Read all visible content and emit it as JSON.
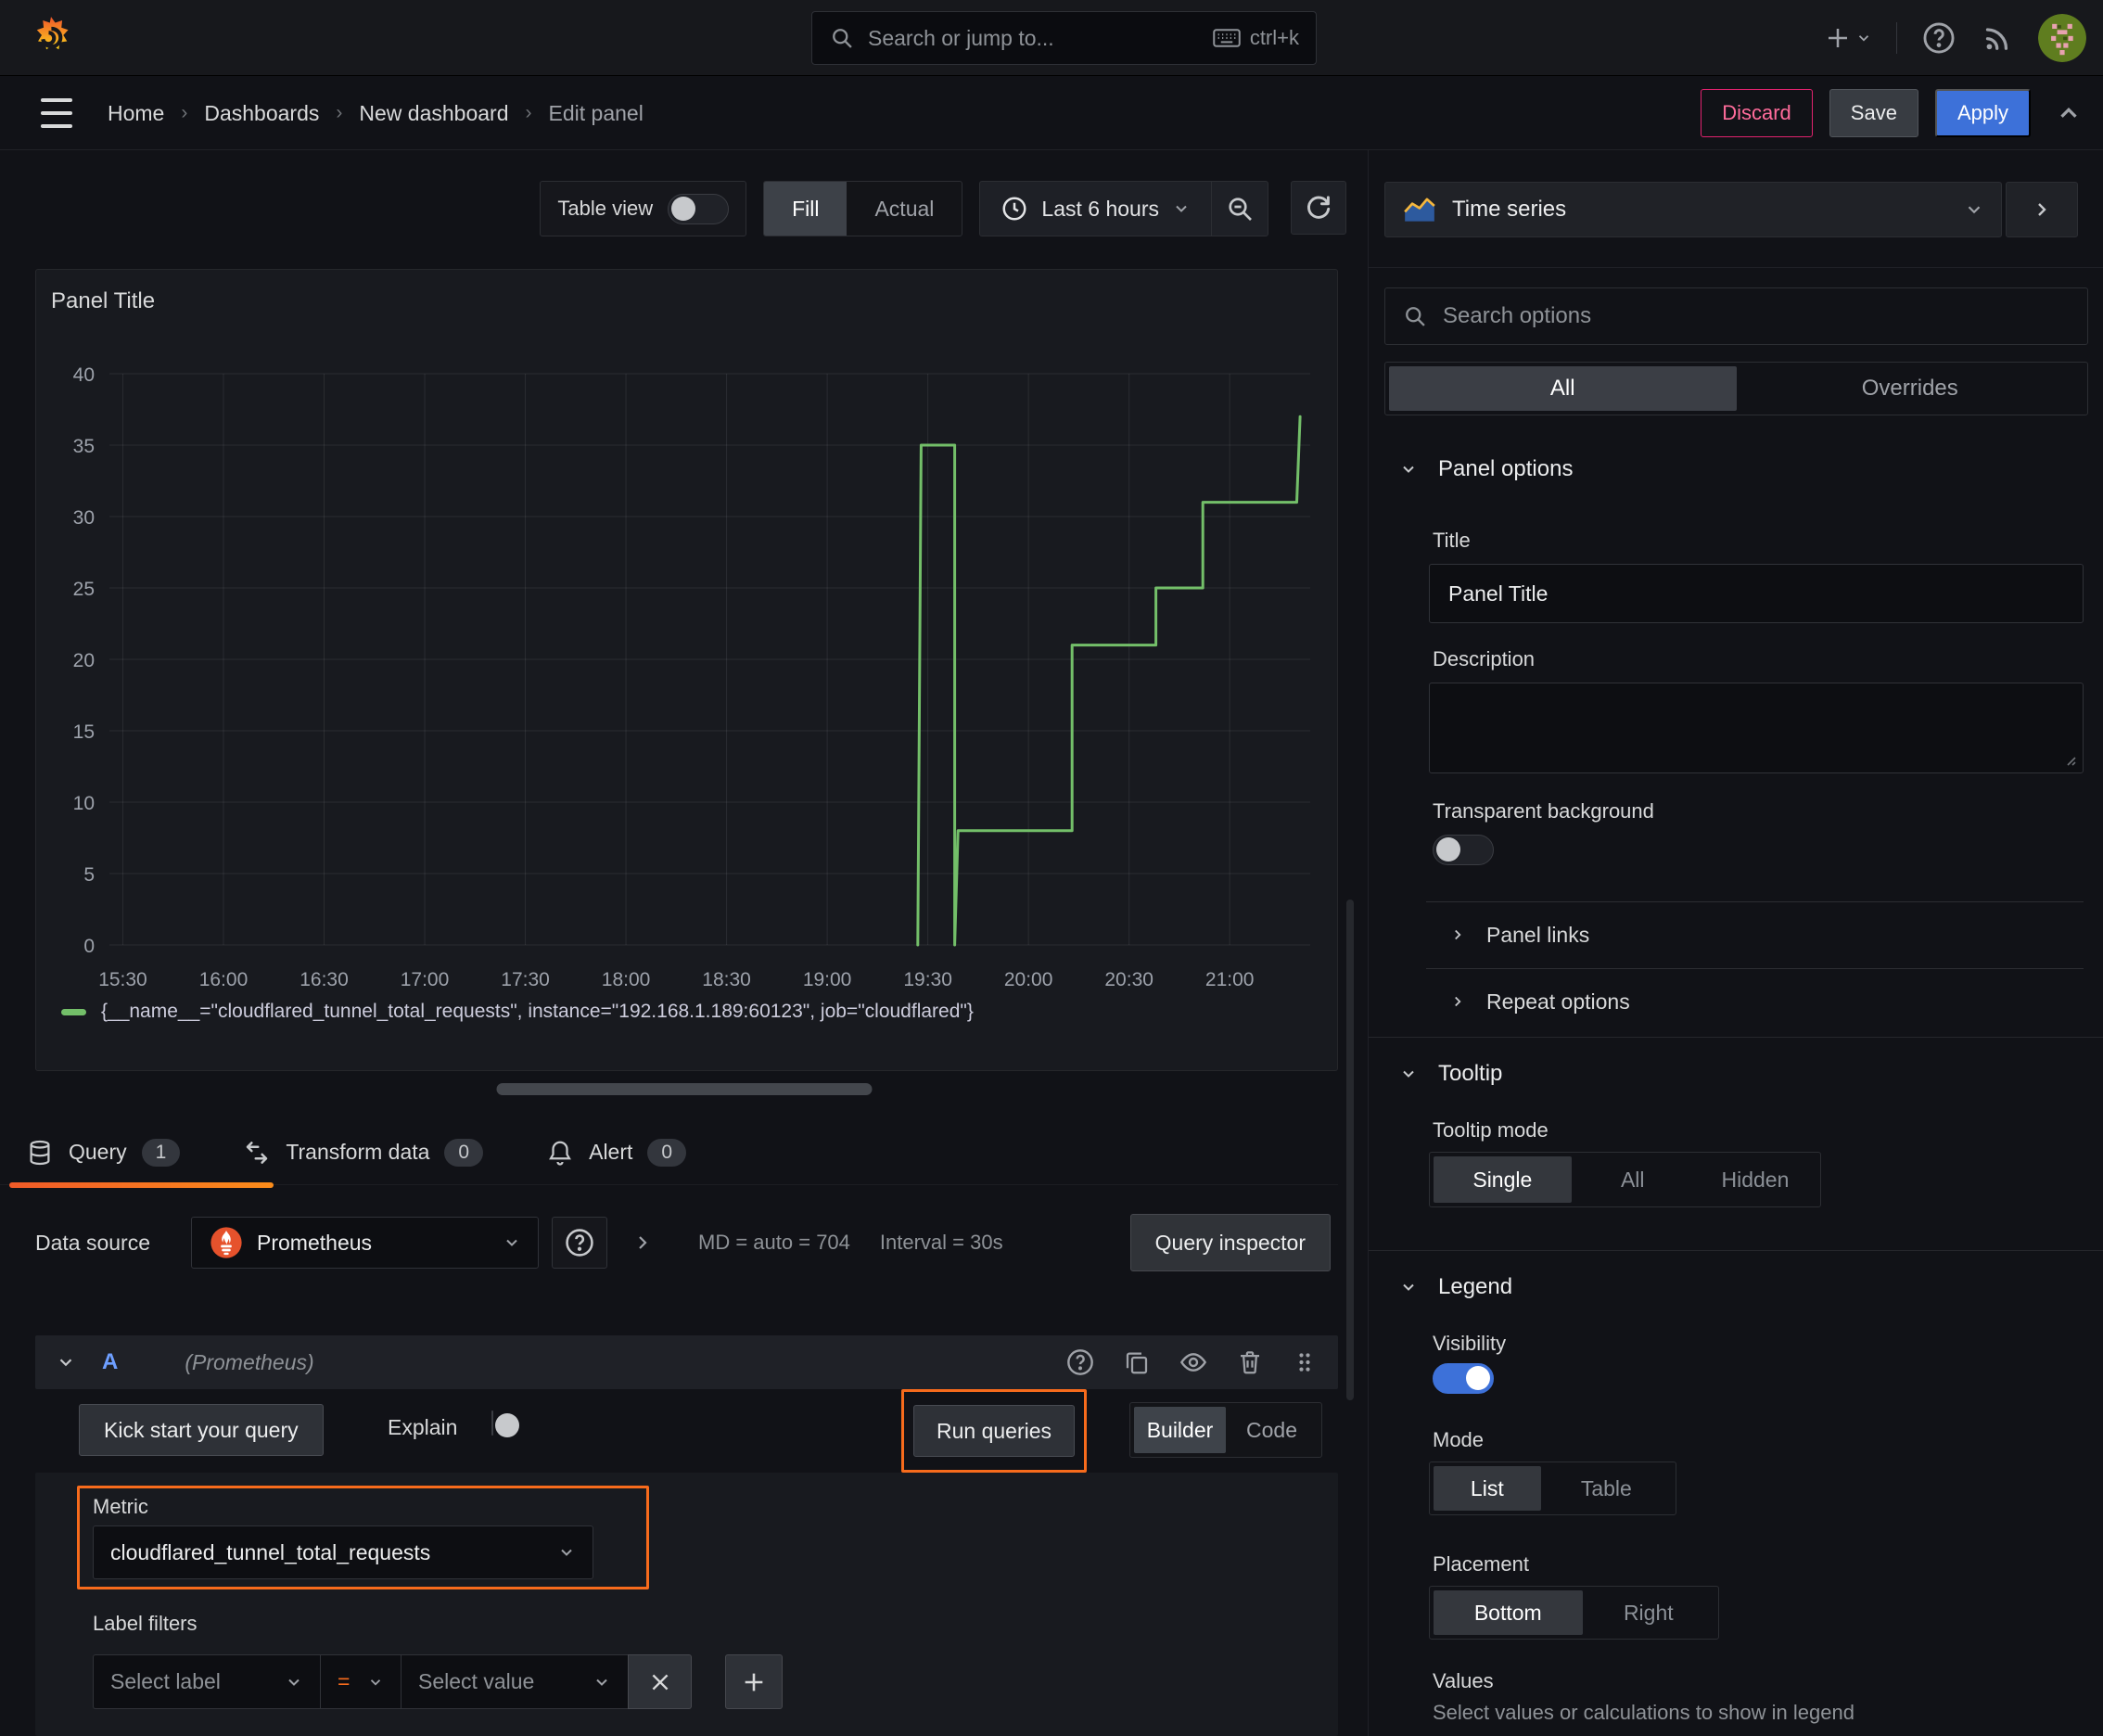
{
  "topbar": {
    "search_placeholder": "Search or jump to...",
    "shortcut": "ctrl+k"
  },
  "breadcrumb": {
    "items": [
      {
        "label": "Home"
      },
      {
        "label": "Dashboards"
      },
      {
        "label": "New dashboard"
      },
      {
        "label": "Edit panel"
      }
    ]
  },
  "actions": {
    "discard": "Discard",
    "save": "Save",
    "apply": "Apply"
  },
  "toolbar": {
    "table_view_label": "Table view",
    "fill_label": "Fill",
    "actual_label": "Actual",
    "time_range_label": "Last 6 hours"
  },
  "panel": {
    "title": "Panel Title"
  },
  "chart_data": {
    "type": "line",
    "title": "Panel Title",
    "xlabel": "",
    "ylabel": "",
    "x_range": [
      "15:26",
      "21:24"
    ],
    "x_ticks": [
      "15:30",
      "16:00",
      "16:30",
      "17:00",
      "17:30",
      "18:00",
      "18:30",
      "19:00",
      "19:30",
      "20:00",
      "20:30",
      "21:00"
    ],
    "ylim": [
      0,
      40
    ],
    "y_ticks": [
      0,
      5,
      10,
      15,
      20,
      25,
      30,
      35,
      40
    ],
    "grid": true,
    "legend_position": "bottom",
    "series": [
      {
        "name": "{__name__=\"cloudflared_tunnel_total_requests\", instance=\"192.168.1.189:60123\", job=\"cloudflared\"}",
        "color": "#73bf69",
        "points": [
          [
            "19:27",
            0
          ],
          [
            "19:28",
            35
          ],
          [
            "19:38",
            35
          ],
          [
            "19:38",
            0
          ],
          [
            "19:39",
            8
          ],
          [
            "20:13",
            8
          ],
          [
            "20:13",
            21
          ],
          [
            "20:38",
            21
          ],
          [
            "20:38",
            25
          ],
          [
            "20:52",
            25
          ],
          [
            "20:52",
            31
          ],
          [
            "21:20",
            31
          ],
          [
            "21:21",
            37
          ]
        ]
      }
    ]
  },
  "tabs": {
    "query": {
      "label": "Query",
      "count": "1"
    },
    "transform": {
      "label": "Transform data",
      "count": "0"
    },
    "alert": {
      "label": "Alert",
      "count": "0"
    }
  },
  "datasource": {
    "label": "Data source",
    "name": "Prometheus",
    "stats_md": "MD = auto = 704",
    "stats_interval": "Interval = 30s",
    "inspector_label": "Query inspector"
  },
  "query_a": {
    "refid": "A",
    "ds_hint": "(Prometheus)",
    "kickstart_label": "Kick start your query",
    "explain_label": "Explain",
    "run_label": "Run queries",
    "builder_label": "Builder",
    "code_label": "Code"
  },
  "metric_editor": {
    "metric_label": "Metric",
    "metric_value": "cloudflared_tunnel_total_requests",
    "filters_label": "Label filters",
    "select_label_placeholder": "Select label",
    "operator": "=",
    "select_value_placeholder": "Select value"
  },
  "viz_picker": {
    "name": "Time series"
  },
  "options": {
    "search_placeholder": "Search options",
    "tab_all": "All",
    "tab_overrides": "Overrides",
    "panel_options": {
      "heading": "Panel options",
      "title_label": "Title",
      "title_value": "Panel Title",
      "description_label": "Description",
      "transparent_label": "Transparent background",
      "panel_links": "Panel links",
      "repeat_options": "Repeat options"
    },
    "tooltip": {
      "heading": "Tooltip",
      "mode_label": "Tooltip mode",
      "modes": [
        "Single",
        "All",
        "Hidden"
      ],
      "selected_mode": "Single"
    },
    "legend": {
      "heading": "Legend",
      "visibility_label": "Visibility",
      "mode_label": "Mode",
      "modes": [
        "List",
        "Table"
      ],
      "selected_mode": "List",
      "placement_label": "Placement",
      "placements": [
        "Bottom",
        "Right"
      ],
      "selected_placement": "Bottom",
      "values_label": "Values",
      "values_help": "Select values or calculations to show in legend"
    }
  }
}
